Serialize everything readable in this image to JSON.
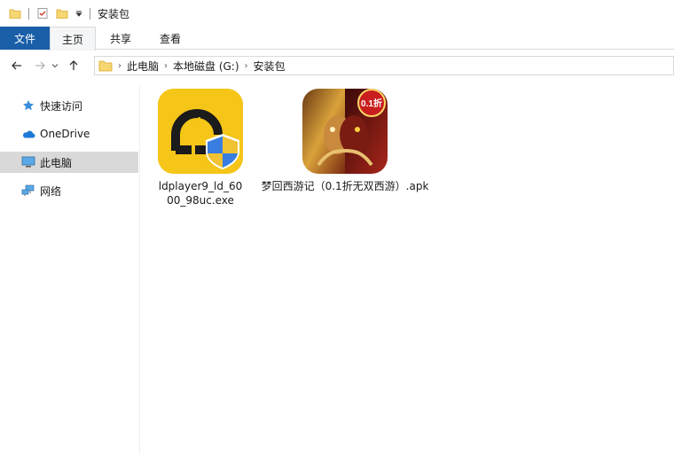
{
  "window": {
    "title": "安装包"
  },
  "ribbon": {
    "tabs": [
      {
        "label": "文件"
      },
      {
        "label": "主页"
      },
      {
        "label": "共享"
      },
      {
        "label": "查看"
      }
    ]
  },
  "address": {
    "crumbs": [
      "此电脑",
      "本地磁盘 (G:)",
      "安装包"
    ]
  },
  "sidebar": {
    "items": [
      {
        "label": "快速访问",
        "icon": "star-icon"
      },
      {
        "label": "OneDrive",
        "icon": "cloud-icon"
      },
      {
        "label": "此电脑",
        "icon": "computer-icon",
        "selected": true
      },
      {
        "label": "网络",
        "icon": "network-icon"
      }
    ]
  },
  "files": [
    {
      "name": "ldplayer9_ld_6000_98uc.exe",
      "icon": "ldplayer-icon"
    },
    {
      "name": "梦回西游记（0.1折无双西游）.apk",
      "icon": "game-apk-icon"
    }
  ],
  "colors": {
    "file_tab": "#1a5ea8",
    "ldplayer_bg": "#f5c518",
    "selected_nav": "#d9d9d9"
  }
}
